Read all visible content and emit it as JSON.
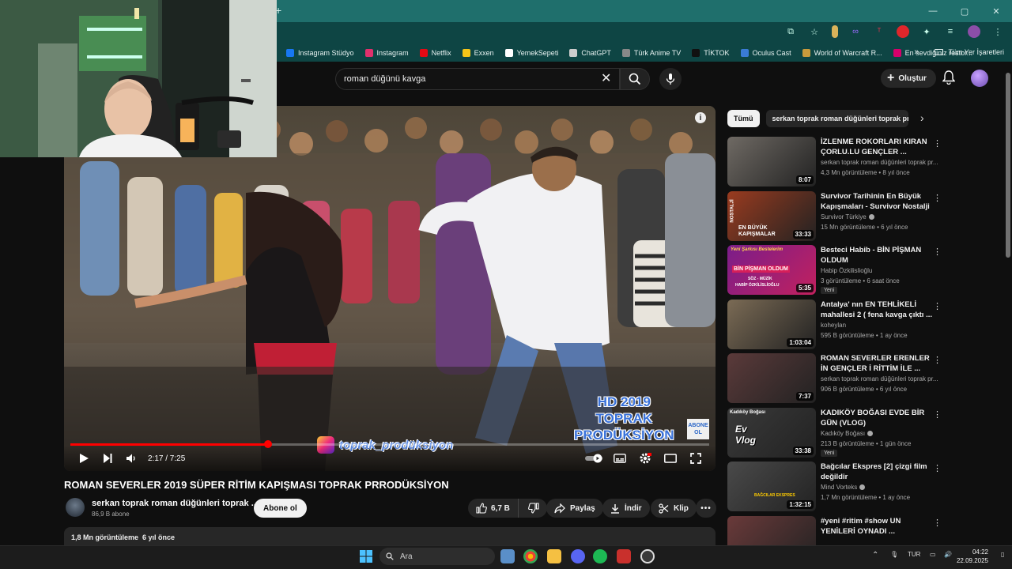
{
  "browser": {
    "bookmarks": [
      {
        "label": "Instagram Stüdyo",
        "color": "#1877f2"
      },
      {
        "label": "Instagram",
        "color": "#e1306c"
      },
      {
        "label": "Netflix",
        "color": "#e50914"
      },
      {
        "label": "Exxen",
        "color": "#f5c518"
      },
      {
        "label": "YemekSepeti",
        "color": "#ffffff"
      },
      {
        "label": "ChatGPT",
        "color": "#cccccc"
      },
      {
        "label": "Türk Anime TV",
        "color": "#888888"
      },
      {
        "label": "TİKTOK",
        "color": "#111111"
      },
      {
        "label": "Oculus Cast",
        "color": "#3a7bd5"
      },
      {
        "label": "World of Warcraft R...",
        "color": "#c89b3c"
      },
      {
        "label": "En sevdiğiniz restor...",
        "color": "#d6006b"
      }
    ],
    "bookmarks_more": "»",
    "all_bookmarks": "Tüm Yer İşaretleri",
    "new_tab": "+"
  },
  "header": {
    "search_value": "roman düğünü kavga",
    "create_label": "Oluştur"
  },
  "player": {
    "current_time": "2:17",
    "duration": "7:25",
    "time_display": "2:17 / 7:25",
    "progress": 0.31,
    "watermark_line1": "HD 2019",
    "watermark_line2": "TOPRAK",
    "watermark_line3": "PRODÜKSİYON",
    "instagram_handle": "toprak_prodüksiyon",
    "abone_badge": "ABONE OL"
  },
  "video": {
    "title": "ROMAN SEVERLER 2019 SÜPER RİTİM KAPIŞMASI TOPRAK PRRODÜKSİYON",
    "channel": "serkan toprak roman düğünleri toprak ...",
    "subscribers": "86,9 B abone",
    "subscribe_label": "Abone ol",
    "likes": "6,7 B",
    "share_label": "Paylaş",
    "download_label": "İndir",
    "clip_label": "Klip",
    "views": "1,8 Mn görüntüleme",
    "age": "6 yıl önce"
  },
  "sidebar": {
    "chips": [
      "Tümü",
      "serkan toprak roman düğünleri toprak prod"
    ],
    "recs": [
      {
        "title": "İZLENME ROKORLARI KIRAN ÇORLU.LU GENÇLER ...",
        "channel": "serkan toprak roman düğünleri toprak pr...",
        "meta": "4,3 Mn görüntüleme • 8 yıl önce",
        "duration": "8:07",
        "badge": "",
        "verified": false,
        "color": "#6f6a64"
      },
      {
        "title": "Survivor Tarihinin En Büyük Kapışmaları - Survivor Nostalji",
        "channel": "Survivor Türkiye",
        "meta": "15 Mn görüntüleme • 6 yıl önce",
        "duration": "33:33",
        "badge": "",
        "verified": true,
        "color": "#9a3b1f"
      },
      {
        "title": "Besteci Habib - BİN PİŞMAN OLDUM",
        "channel": "Habip Özkilislioğlu",
        "meta": "3 görüntüleme • 6 saat önce",
        "duration": "5:35",
        "badge": "Yeni",
        "verified": false,
        "color": "#b2215f"
      },
      {
        "title": "Antalya' nın EN TEHLİKELİ mahallesi 2 ( fena kavga çıktı ...",
        "channel": "koheylan",
        "meta": "595 B görüntüleme • 1 ay önce",
        "duration": "1:03:04",
        "badge": "",
        "verified": false,
        "color": "#7b6b55"
      },
      {
        "title": "ROMAN SEVERLER ERENLER İN GENÇLER İ RİTTİM İLE ...",
        "channel": "serkan toprak roman düğünleri toprak pr...",
        "meta": "906 B görüntüleme • 6 yıl önce",
        "duration": "7:37",
        "badge": "",
        "verified": false,
        "color": "#5b3a3a"
      },
      {
        "title": "KADIKÖY BOĞASI EVDE BİR GÜN (VLOG)",
        "channel": "Kadıköy Boğası",
        "meta": "213 B görüntüleme • 1 gün önce",
        "duration": "33:38",
        "badge": "Yeni",
        "verified": true,
        "color": "#3a3a3a"
      },
      {
        "title": "Bağcılar Ekspres [2] çizgi film değildir",
        "channel": "Mind Vorteks",
        "meta": "1,7 Mn görüntüleme • 1 ay önce",
        "duration": "1:32:15",
        "badge": "",
        "verified": true,
        "color": "#4a4a4a"
      },
      {
        "title": "#yeni #ritim #show UN YENİLERİ OYNADI ...",
        "channel": "",
        "meta": "",
        "duration": "",
        "badge": "",
        "verified": false,
        "color": "#6a3a3a"
      }
    ],
    "thumb_texts": {
      "survivor_caption": "EN BÜYÜK KAPIŞMALAR",
      "survivor_side": "NOSTALJİ",
      "besteci_top": "Yeni Şarkısı Bestelerim",
      "besteci_main": "BİN PİŞMAN OLDUM",
      "besteci_sub": "SÖZ - MÜZİK",
      "besteci_name": "HABİP ÖZKİLİSLİOĞLU",
      "kadikoy_top": "Kadıköy Boğası",
      "kadikoy_main": "Ev Vlog",
      "bagcilar": "BAĞCILAR EKSPRES"
    }
  },
  "taskbar": {
    "search_label": "Ara",
    "lang": "TUR",
    "time": "04:22",
    "date": "22.09.2025"
  }
}
